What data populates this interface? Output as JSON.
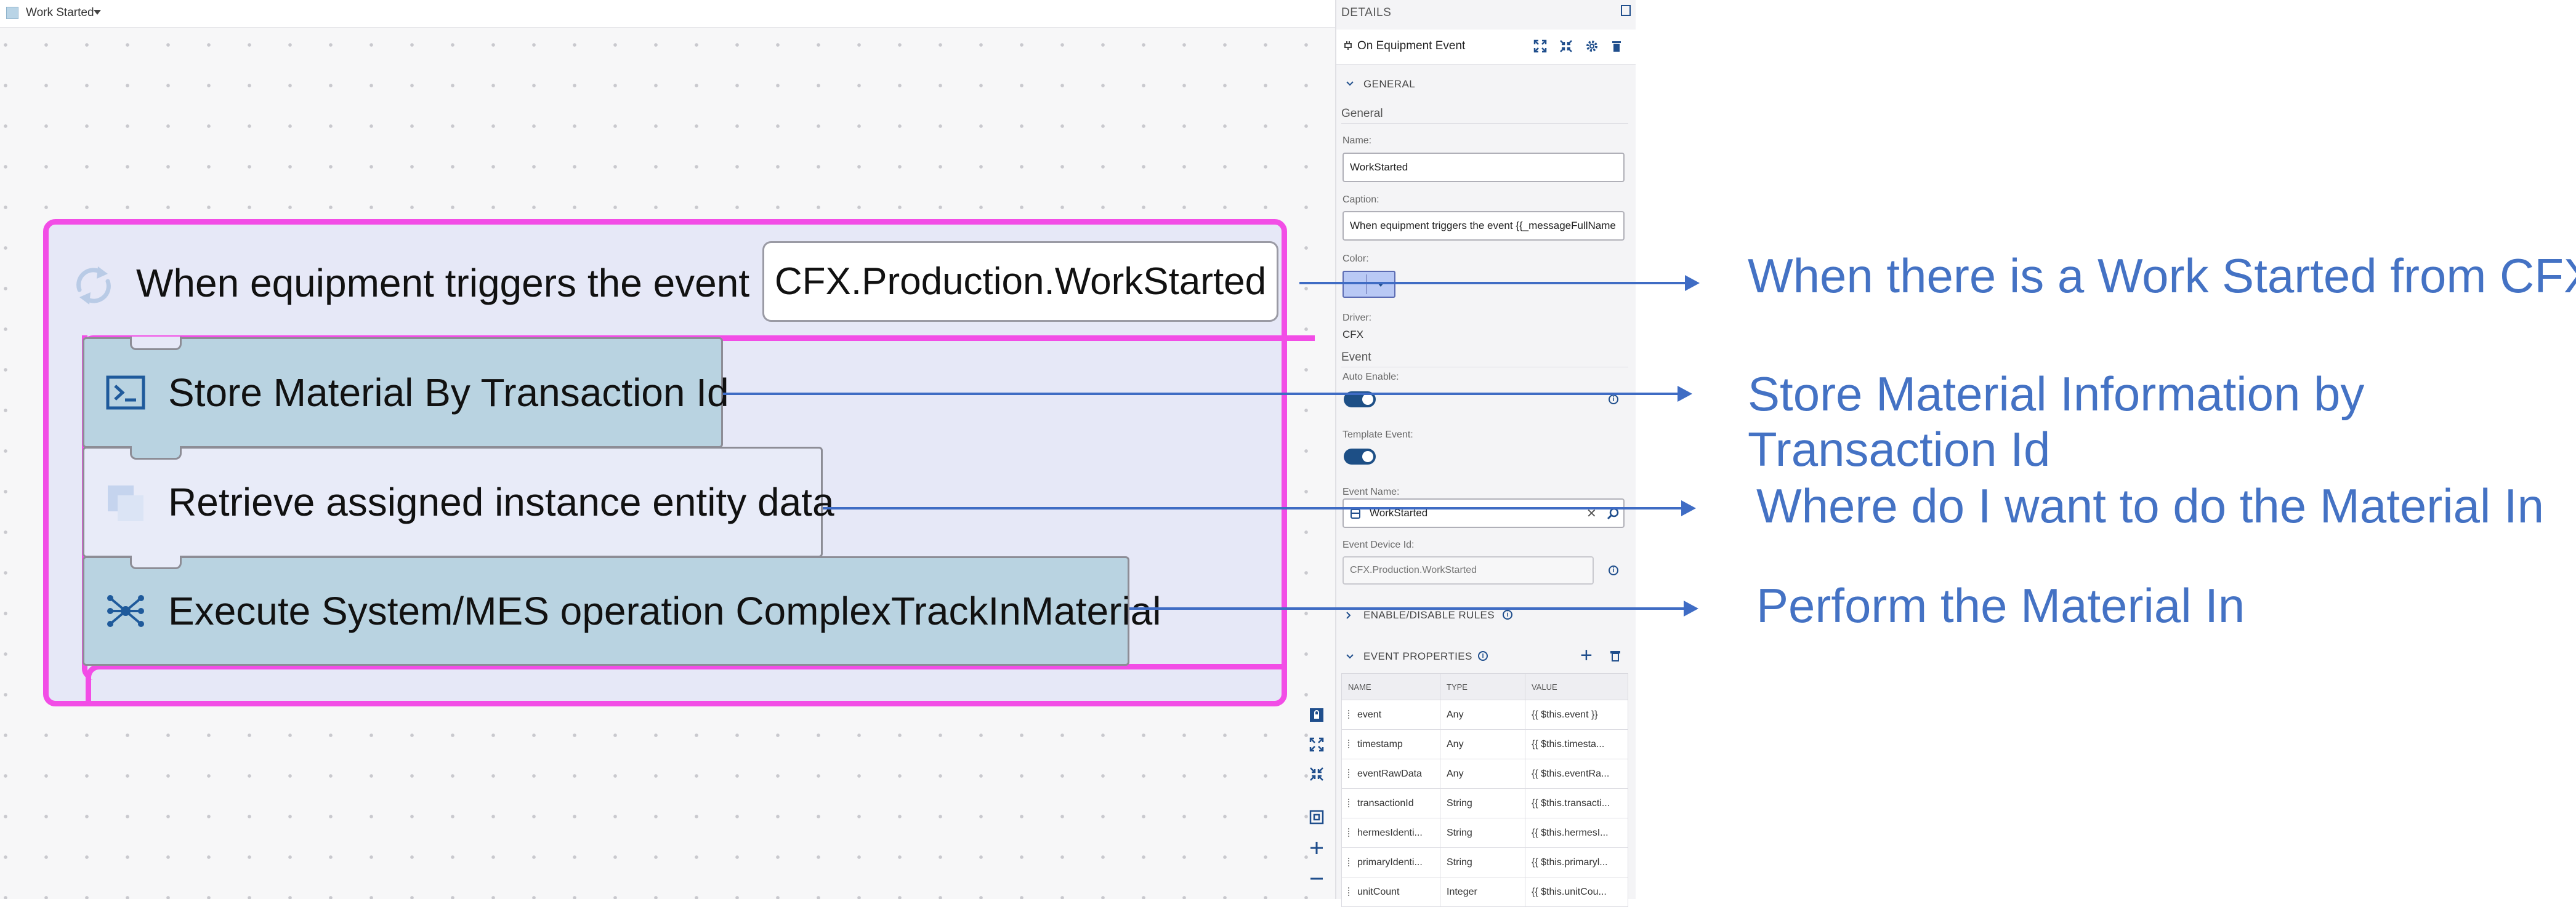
{
  "workflow": {
    "title": "Work Started"
  },
  "event": {
    "text": "When equipment triggers the event",
    "name": "CFX.Production.WorkStarted"
  },
  "tasks": [
    {
      "label": "Store Material By Transaction Id",
      "icon": "terminal-icon"
    },
    {
      "label": "Retrieve assigned instance entity data",
      "icon": "entity-icon"
    },
    {
      "label": "Execute System/MES operation ComplexTrackInMaterial",
      "icon": "network-icon"
    }
  ],
  "details": {
    "title": "DETAILS",
    "header_title": "On Equipment Event",
    "general_section": "GENERAL",
    "general_group": "General",
    "name_label": "Name:",
    "name_value": "WorkStarted",
    "caption_label": "Caption:",
    "caption_value": "When equipment triggers the event {{_messageFullName",
    "color_label": "Color:",
    "driver_label": "Driver:",
    "driver_value": "CFX",
    "event_group": "Event",
    "auto_enable_label": "Auto Enable:",
    "template_event_label": "Template Event:",
    "event_name_label": "Event Name:",
    "event_name_value": "WorkStarted",
    "event_device_label": "Event Device Id:",
    "event_device_placeholder": "CFX.Production.WorkStarted",
    "enable_rules_section": "ENABLE/DISABLE RULES",
    "event_props_section": "EVENT PROPERTIES",
    "colors": {
      "accent": "#1d4f86",
      "swatch": "#b9c9f5"
    }
  },
  "properties_table": {
    "headers": [
      "NAME",
      "TYPE",
      "VALUE"
    ],
    "rows": [
      {
        "name": "event",
        "type": "Any",
        "value": "{{ $this.event }}"
      },
      {
        "name": "timestamp",
        "type": "Any",
        "value": "{{ $this.timesta..."
      },
      {
        "name": "eventRawData",
        "type": "Any",
        "value": "{{ $this.eventRa..."
      },
      {
        "name": "transactionId",
        "type": "String",
        "value": "{{ $this.transacti..."
      },
      {
        "name": "hermesIdenti...",
        "type": "String",
        "value": "{{ $this.hermesI..."
      },
      {
        "name": "primaryIdenti...",
        "type": "String",
        "value": "{{ $this.primaryl..."
      },
      {
        "name": "unitCount",
        "type": "Integer",
        "value": "{{ $this.unitCou..."
      }
    ]
  },
  "annotations": [
    "When there is a Work Started from CFX",
    "Store Material Information by Transaction Id",
    "Where do I want to do the Material In",
    "Perform the Material In"
  ],
  "colors": {
    "highlight": "#f24de6",
    "annotation": "#4472c4",
    "task_blue": "#b9d3e1"
  }
}
